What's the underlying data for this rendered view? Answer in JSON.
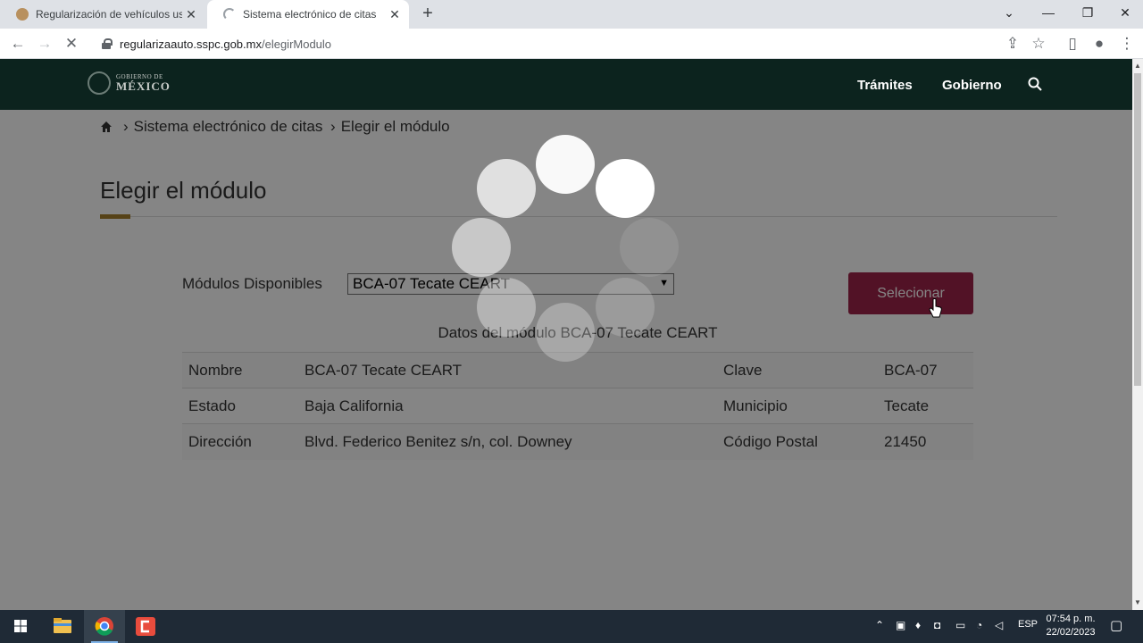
{
  "browser": {
    "tabs": [
      {
        "title": "Regularización de vehículos usad",
        "active": false
      },
      {
        "title": "Sistema electrónico de citas",
        "active": true
      }
    ],
    "url_host": "regularizaauto.sspc.gob.mx",
    "url_path": "/elegirModulo"
  },
  "header": {
    "logo_small": "GOBIERNO DE",
    "logo_big": "MÉXICO",
    "nav": [
      "Trámites",
      "Gobierno"
    ]
  },
  "breadcrumb": {
    "items": [
      "Sistema electrónico de citas",
      "Elegir el módulo"
    ]
  },
  "page": {
    "title": "Elegir el módulo",
    "modules_label": "Módulos Disponibles",
    "selected_module": "BCA-07 Tecate CEART",
    "select_button": "Selecionar",
    "caption": "Datos del módulo BCA-07 Tecate CEART"
  },
  "module_table": {
    "rows": [
      [
        "Nombre",
        "BCA-07 Tecate CEART",
        "Clave",
        "BCA-07"
      ],
      [
        "Estado",
        "Baja California",
        "Municipio",
        "Tecate"
      ],
      [
        "Dirección",
        "Blvd. Federico Benitez s/n, col. Downey",
        "Código Postal",
        "21450"
      ]
    ]
  },
  "colors": {
    "header_bg": "#0c231e",
    "accent_button": "#9d2449",
    "title_underline": "#a57f2c"
  },
  "taskbar": {
    "lang": "ESP",
    "time": "07:54 p. m.",
    "date": "22/02/2023"
  }
}
